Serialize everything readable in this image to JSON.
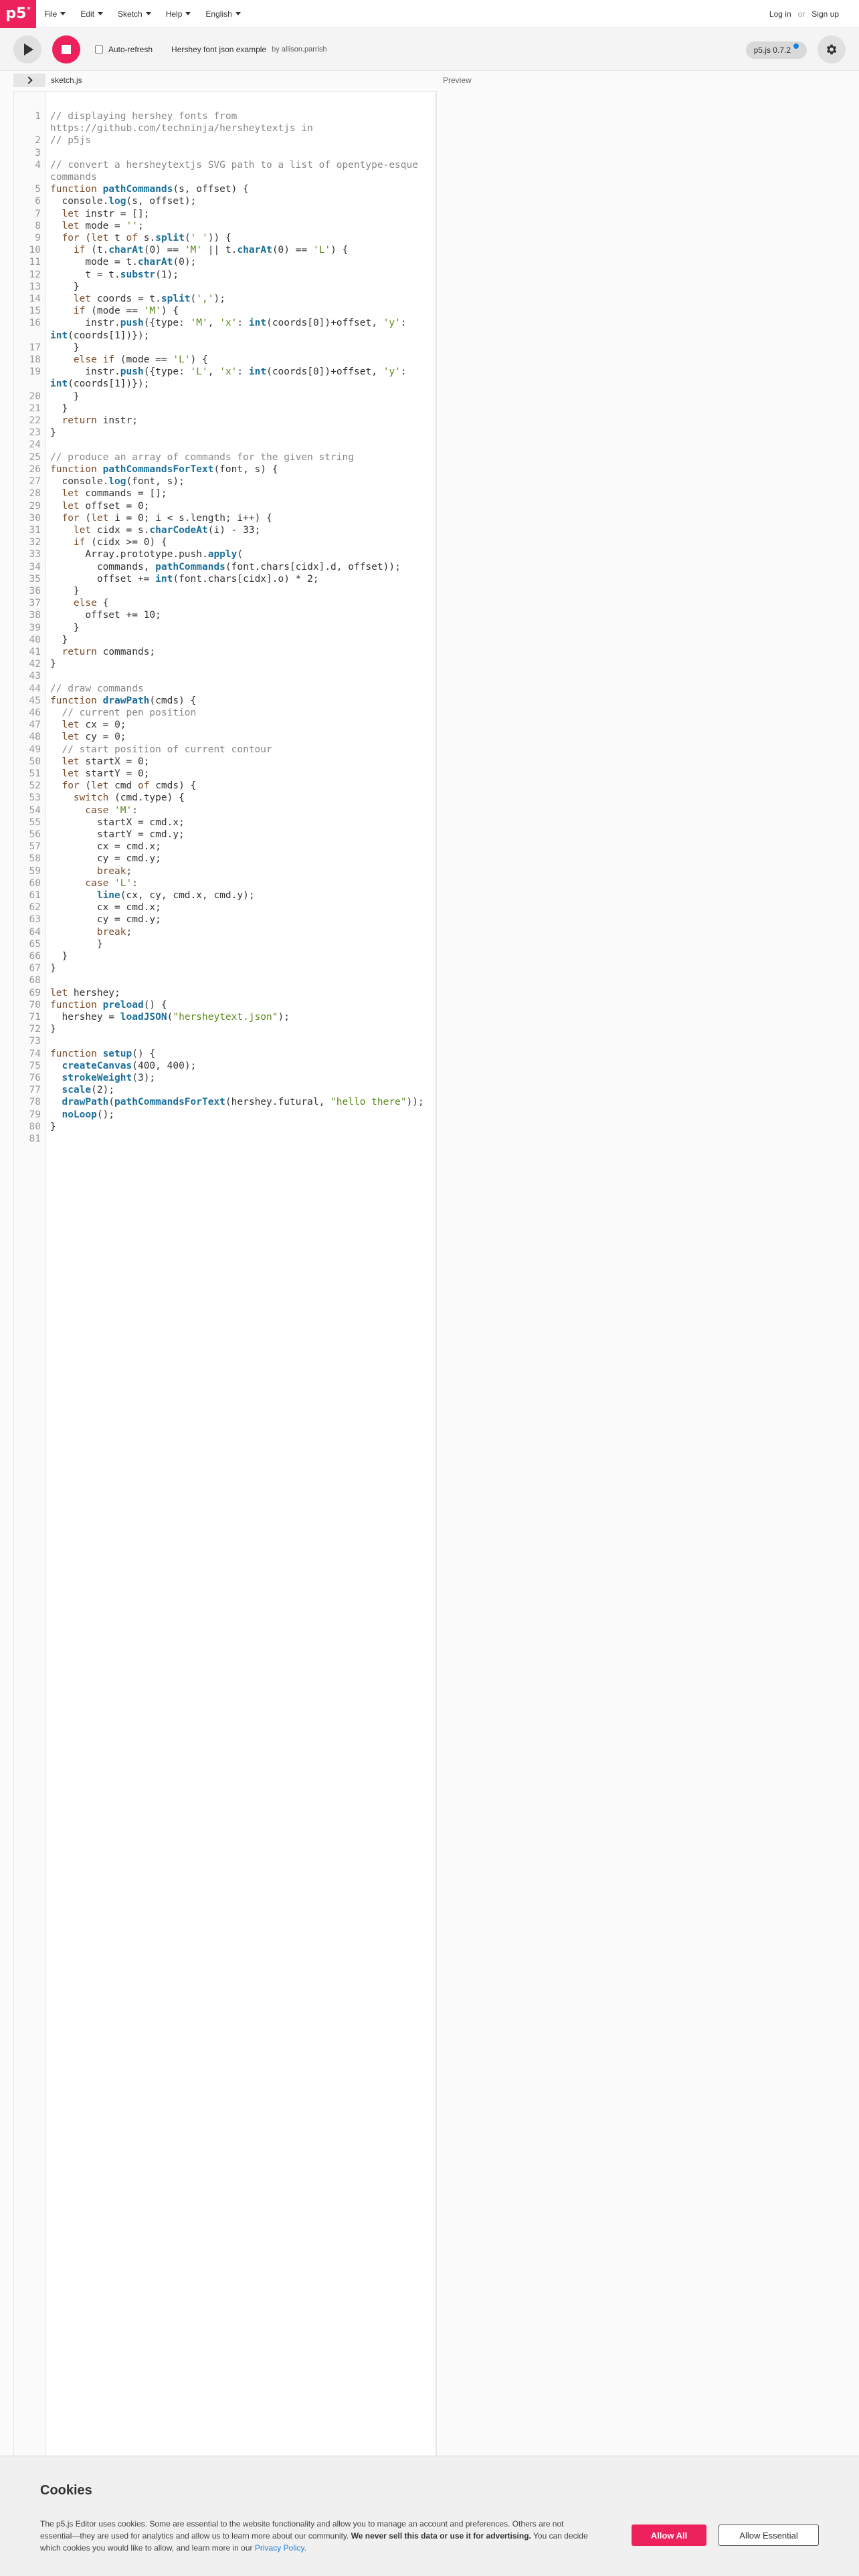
{
  "nav": {
    "logo": "p5",
    "logo_sup": "*",
    "menu": [
      "File",
      "Edit",
      "Sketch",
      "Help",
      "English"
    ],
    "login": "Log in",
    "or": "or",
    "signup": "Sign up"
  },
  "toolbar": {
    "autorefresh_label": "Auto-refresh",
    "project_name": "Hershey font json example",
    "by_label": "by",
    "author": "allison.parrish",
    "version": "p5.js 0.7.2"
  },
  "editor": {
    "file_name": "sketch.js",
    "preview_label": "Preview",
    "lines": [
      {
        "n": "1",
        "text": "// displaying hershey fonts from https://github.com/techninja/hersheytextjs in"
      },
      {
        "n": "2",
        "text": "// p5js"
      },
      {
        "n": "3",
        "text": ""
      },
      {
        "n": "4",
        "text": "// convert a hersheytextjs SVG path to a list of opentype-esque commands"
      },
      {
        "n": "5",
        "text": "function pathCommands(s, offset) {"
      },
      {
        "n": "6",
        "text": "  console.log(s, offset);"
      },
      {
        "n": "7",
        "text": "  let instr = [];"
      },
      {
        "n": "8",
        "text": "  let mode = '';"
      },
      {
        "n": "9",
        "text": "  for (let t of s.split(' ')) {"
      },
      {
        "n": "10",
        "text": "    if (t.charAt(0) == 'M' || t.charAt(0) == 'L') {"
      },
      {
        "n": "11",
        "text": "      mode = t.charAt(0);"
      },
      {
        "n": "12",
        "text": "      t = t.substr(1);"
      },
      {
        "n": "13",
        "text": "    }"
      },
      {
        "n": "14",
        "text": "    let coords = t.split(',');"
      },
      {
        "n": "15",
        "text": "    if (mode == 'M') {"
      },
      {
        "n": "16",
        "text": "      instr.push({type: 'M', 'x': int(coords[0])+offset, 'y': int(coords[1])});"
      },
      {
        "n": "17",
        "text": "    }"
      },
      {
        "n": "18",
        "text": "    else if (mode == 'L') {"
      },
      {
        "n": "19",
        "text": "      instr.push({type: 'L', 'x': int(coords[0])+offset, 'y': int(coords[1])});"
      },
      {
        "n": "20",
        "text": "    }"
      },
      {
        "n": "21",
        "text": "  }"
      },
      {
        "n": "22",
        "text": "  return instr;"
      },
      {
        "n": "23",
        "text": "}"
      },
      {
        "n": "24",
        "text": ""
      },
      {
        "n": "25",
        "text": "// produce an array of commands for the given string"
      },
      {
        "n": "26",
        "text": "function pathCommandsForText(font, s) {"
      },
      {
        "n": "27",
        "text": "  console.log(font, s);"
      },
      {
        "n": "28",
        "text": "  let commands = [];"
      },
      {
        "n": "29",
        "text": "  let offset = 0;"
      },
      {
        "n": "30",
        "text": "  for (let i = 0; i < s.length; i++) {"
      },
      {
        "n": "31",
        "text": "    let cidx = s.charCodeAt(i) - 33;"
      },
      {
        "n": "32",
        "text": "    if (cidx >= 0) {"
      },
      {
        "n": "33",
        "text": "      Array.prototype.push.apply("
      },
      {
        "n": "34",
        "text": "        commands, pathCommands(font.chars[cidx].d, offset));"
      },
      {
        "n": "35",
        "text": "        offset += int(font.chars[cidx].o) * 2;"
      },
      {
        "n": "36",
        "text": "    }"
      },
      {
        "n": "37",
        "text": "    else {"
      },
      {
        "n": "38",
        "text": "      offset += 10;"
      },
      {
        "n": "39",
        "text": "    }"
      },
      {
        "n": "40",
        "text": "  }"
      },
      {
        "n": "41",
        "text": "  return commands;"
      },
      {
        "n": "42",
        "text": "}"
      },
      {
        "n": "43",
        "text": ""
      },
      {
        "n": "44",
        "text": "// draw commands"
      },
      {
        "n": "45",
        "text": "function drawPath(cmds) {"
      },
      {
        "n": "46",
        "text": "  // current pen position"
      },
      {
        "n": "47",
        "text": "  let cx = 0;"
      },
      {
        "n": "48",
        "text": "  let cy = 0;"
      },
      {
        "n": "49",
        "text": "  // start position of current contour"
      },
      {
        "n": "50",
        "text": "  let startX = 0;"
      },
      {
        "n": "51",
        "text": "  let startY = 0;"
      },
      {
        "n": "52",
        "text": "  for (let cmd of cmds) {"
      },
      {
        "n": "53",
        "text": "    switch (cmd.type) {"
      },
      {
        "n": "54",
        "text": "      case 'M':"
      },
      {
        "n": "55",
        "text": "        startX = cmd.x;"
      },
      {
        "n": "56",
        "text": "        startY = cmd.y;"
      },
      {
        "n": "57",
        "text": "        cx = cmd.x;"
      },
      {
        "n": "58",
        "text": "        cy = cmd.y;"
      },
      {
        "n": "59",
        "text": "        break;"
      },
      {
        "n": "60",
        "text": "      case 'L':"
      },
      {
        "n": "61",
        "text": "        line(cx, cy, cmd.x, cmd.y);"
      },
      {
        "n": "62",
        "text": "        cx = cmd.x;"
      },
      {
        "n": "63",
        "text": "        cy = cmd.y;"
      },
      {
        "n": "64",
        "text": "        break;"
      },
      {
        "n": "65",
        "text": "        }"
      },
      {
        "n": "66",
        "text": "  }"
      },
      {
        "n": "67",
        "text": "}"
      },
      {
        "n": "68",
        "text": ""
      },
      {
        "n": "69",
        "text": "let hershey;"
      },
      {
        "n": "70",
        "text": "function preload() {"
      },
      {
        "n": "71",
        "text": "  hershey = loadJSON(\"hersheytext.json\");"
      },
      {
        "n": "72",
        "text": "}"
      },
      {
        "n": "73",
        "text": ""
      },
      {
        "n": "74",
        "text": "function setup() {"
      },
      {
        "n": "75",
        "text": "  createCanvas(400, 400);"
      },
      {
        "n": "76",
        "text": "  strokeWeight(3);"
      },
      {
        "n": "77",
        "text": "  scale(2);"
      },
      {
        "n": "78",
        "text": "  drawPath(pathCommandsForText(hershey.futural, \"hello there\"));"
      },
      {
        "n": "79",
        "text": "  noLoop();"
      },
      {
        "n": "80",
        "text": "}"
      },
      {
        "n": "81",
        "text": ""
      }
    ]
  },
  "cookie": {
    "title": "Cookies",
    "text_1": "The p5.js Editor uses cookies. Some are essential to the website functionality and allow you to manage an account and preferences. Others are not essential—they are used for analytics and allow us to learn more about our community.",
    "text_bold": "We never sell this data or use it for advertising.",
    "text_2": "You can decide which cookies you would like to allow, and learn more in our",
    "policy_link": "Privacy Policy",
    "text_end": ".",
    "allow_all": "Allow All",
    "allow_essential": "Allow Essential"
  },
  "colors": {
    "accent": "#ed225d",
    "link": "#1e7fd8"
  }
}
